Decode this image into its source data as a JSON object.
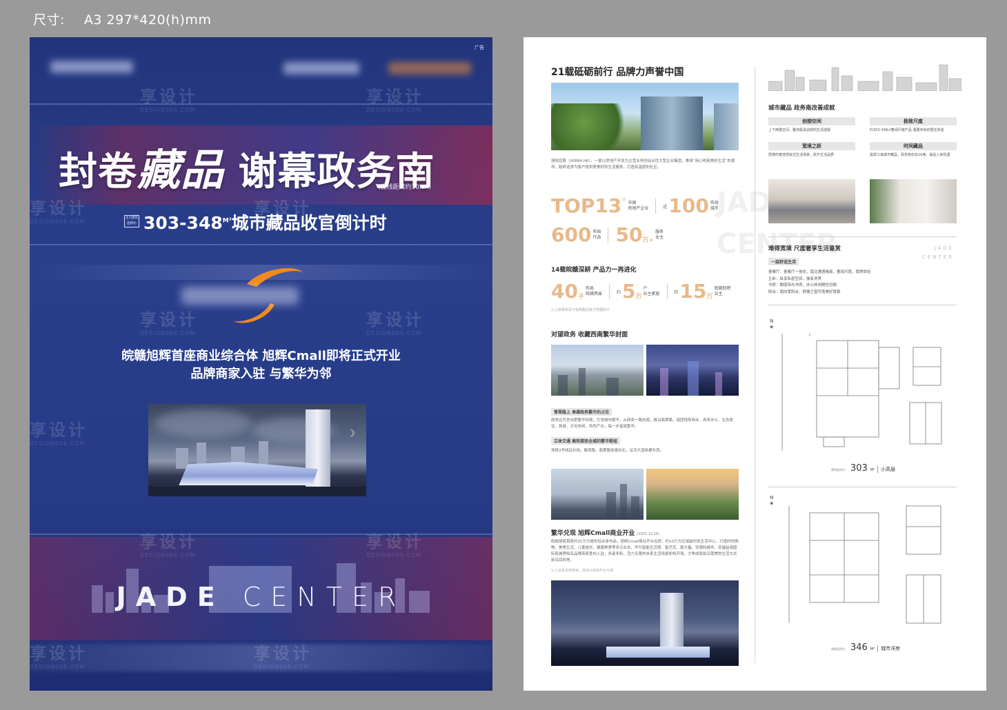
{
  "size_label": {
    "prefix": "尺寸:",
    "value": "A3  297*420(h)mm"
  },
  "left_poster": {
    "ad_tag": "广告",
    "title_part1": "封卷",
    "title_calli": "藏品",
    "title_part2": " 谢幕政务南",
    "title_note": "(直线距离约10KM)",
    "area_badge": "主力建筑面积约",
    "area_range": "303-348",
    "area_unit": "M²",
    "area_tail": "城市藏品收官倒计时",
    "desc_line1": "皖赣旭辉首座商业综合体  旭辉Cmall即将正式开业",
    "desc_line2": "品牌商家入驻  与繁华为邻",
    "jade_bold": "JADE",
    "jade_rest": " CENTER",
    "watermark": "享设计",
    "watermark_sub": "DESIGN006.COM"
  },
  "right_poster": {
    "h1": "21载砥砺前行 品牌力声誉中国",
    "para1": "旭辉控股（00884.HK），一家以房地产开发为主营业务的综合性大型企业集团，秉承“用心构筑美好生活”的使命，始终追求为客户提供更美好的生活服务，打造有温度的社区。",
    "vert_jade": "JADE CENTER",
    "stats1": {
      "top13": "TOP13",
      "top13_sup": "®",
      "top13_sub1": "中国",
      "top13_sub2": "房地产企业",
      "city_pre": "近",
      "city_num": "100",
      "city_sub1": "布局",
      "city_sub2": "城市",
      "works_num": "600",
      "works_sub1": "布局",
      "works_sub2": "作品",
      "owner_num": "50",
      "owner_unit": "万+",
      "owner_sub1": "服务",
      "owner_sub2": "业主"
    },
    "h2a": "14载皖赣深耕 产品力一再进化",
    "stats2": {
      "n1": "40",
      "n1_unit": "子",
      "n1_sub1": "布局",
      "n1_sub2": "皖赣两省",
      "n2_pre": "约",
      "n2": "5",
      "n2_unit": "万",
      "n2_sub1": "户",
      "n2_sub2": "业主家庭",
      "n3_pre": "约",
      "n3": "15",
      "n3_unit": "万",
      "n3_sub1": "皖赣旭辉",
      "n3_sub2": "业主"
    },
    "foot_stats": "以上数据来源于旭辉集团官方数据统计",
    "h2b": "对望政务 收藏西南繁华封面",
    "tag1": "青翠路上 承袭政务繁华的占位",
    "para2": "政务区代言合肥繁华封面，引领城市繁华，从政务一路向南，脉沿翡翠路，组团规划商业、商务办公、生态居住、旅游、文化休闲、特色产业，每一步皆成繁华。",
    "tag2": "立体交通 高效接驳全城的繁华枢纽",
    "para3": "地铁3号线延长线，集贤路、翡翠路快速向北，派河大道纵横东西。",
    "h2c": "繁华兑现 旭辉Cmall商业开业",
    "h2c_note": "(2021.12.25)",
    "para4": "皖赣旭辉首座约31万方城市综合体作品，旭辉Cmall商业开业在即，约10万方区域级时尚生活中心，打造时尚购物、美食生活、儿童成长、健康美食等多元业态，华为智能生活馆、星巴克、周大福、安德利超市、幸福益海国际影城等知名品牌商家意向入驻，多姿多彩、活力无限的未来生活场景即将开场，力争成就前沿尊崇的生活方式前沿目的地。",
    "para4_foot": "以上信息仅供参考，具体以实际开业为准",
    "h3a": "城市藏品 政务南改善成就",
    "features": [
      {
        "title": "创想空间",
        "desc": "上下两重空间，叠加极具创想的生活选题"
      },
      {
        "title": "极致尺度",
        "desc": "约303-348㎡奢阔尺度产品 遇展未有的居住体验"
      },
      {
        "title": "宽境之跃",
        "desc": "层楼的宽境舒就式生活场景，跃升生活品质"
      },
      {
        "title": "时间藏品",
        "desc": "需翠江来城市藏品，政务南仅余16席，最后入来机遇"
      }
    ],
    "jade_small1": "JADE",
    "jade_small2": "CENTER",
    "h3b": "难得宽境 尺度奢享生活鉴赏",
    "sub_tag3": "一层舒适生活",
    "list": [
      "客餐厅：客餐厅一体化，南北通透格局，奢阔尺度，尊崇体验",
      "主卧：纵享私密空间，独有洗界",
      "书房：朝南阳光书房，办公休闲随性切换",
      "阳台：南向宽阳台，舒展之窗尽揽美好景致"
    ],
    "compass": "N",
    "fp1": {
      "pre": "建筑面积约",
      "num": "303",
      "unit": "M²",
      "label": "小高层"
    },
    "fp2": {
      "pre": "建筑面积约",
      "num": "346",
      "unit": "M²",
      "label": "城市洋房"
    }
  },
  "colors": {
    "left_bg": "#263a86",
    "accent_orange": "#e8b98a",
    "swoosh_orange": "#f08a1e"
  }
}
